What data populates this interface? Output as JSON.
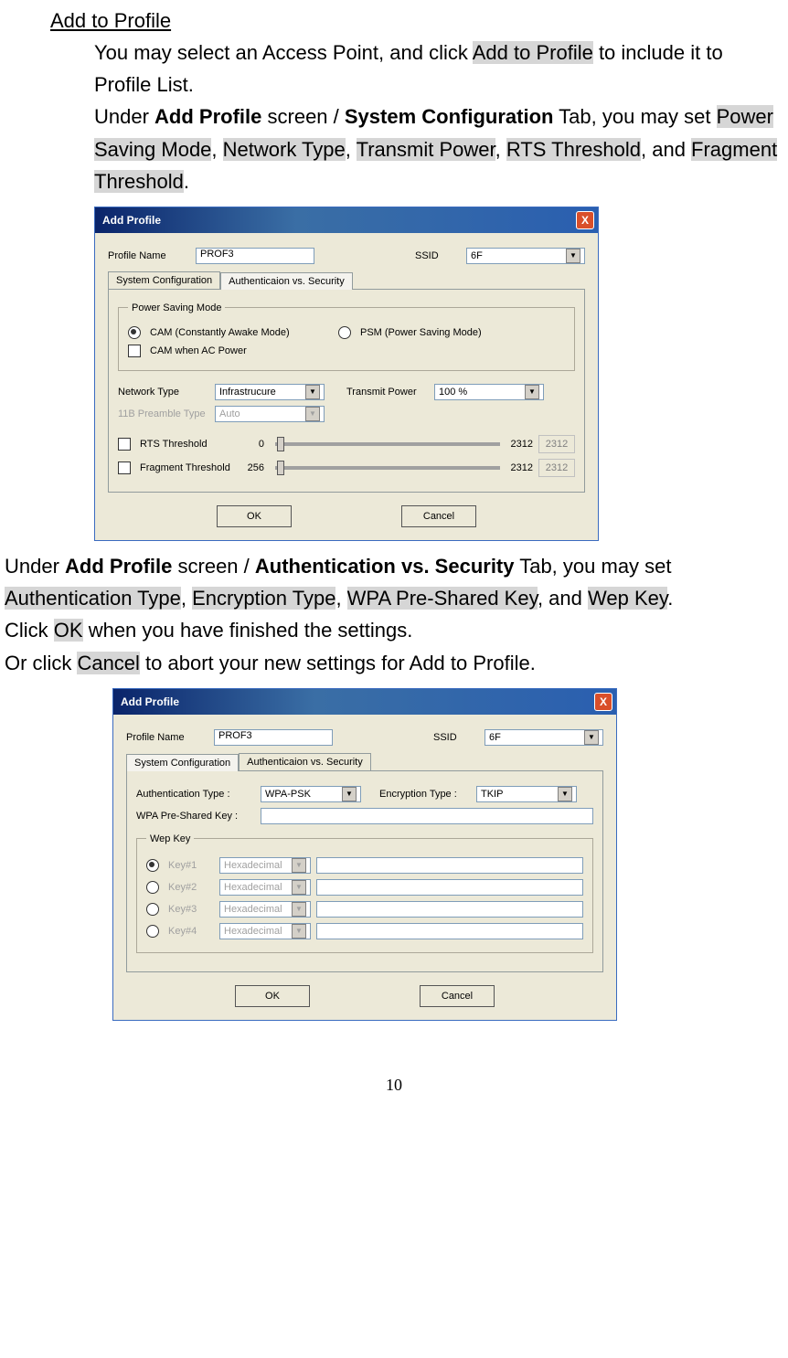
{
  "heading": "Add to Profile",
  "para1a": "You may select an Access Point, and click ",
  "hl_add_to_profile": "Add to Profile",
  "para1b": " to include it to Profile List.",
  "para2a": "Under ",
  "bold_add_profile": "Add Profile",
  "para2b": " screen / ",
  "bold_sysconf": "System Configuration",
  "para2c": " Tab, you may set ",
  "hl_psm": "Power Saving Mode",
  "comma": ", ",
  "hl_nettype": "Network Type",
  "hl_txpower": "Transmit Power",
  "hl_rts": "RTS Threshold",
  "and_text": ", and ",
  "hl_frag": "Fragment Threshold",
  "period": ".",
  "dlg1": {
    "title": "Add Profile",
    "close": "X",
    "profile_name_label": "Profile Name",
    "profile_name_value": "PROF3",
    "ssid_label": "SSID",
    "ssid_value": "6F",
    "tab_sysconf": "System Configuration",
    "tab_auth": "Authenticaion vs. Security",
    "psm_legend": "Power Saving Mode",
    "cam_label": "CAM (Constantly Awake Mode)",
    "psm_label": "PSM (Power Saving Mode)",
    "cam_ac_label": "CAM when AC Power",
    "nettype_label": "Network Type",
    "nettype_value": "Infrastrucure",
    "txpower_label": "Transmit Power",
    "txpower_value": "100 %",
    "preamble_label": "11B Preamble Type",
    "preamble_value": "Auto",
    "rts_label": "RTS Threshold",
    "rts_min": "0",
    "rts_max": "2312",
    "rts_value": "2312",
    "frag_label": "Fragment Threshold",
    "frag_min": "256",
    "frag_max": "2312",
    "frag_value": "2312",
    "ok": "OK",
    "cancel": "Cancel"
  },
  "para3a": "Under ",
  "bold_add_profile2": "Add Profile",
  "para3b": " screen / ",
  "bold_authsec": "Authentication vs. Security",
  "para3c": " Tab, you may set ",
  "hl_authtype": "Authentication Type",
  "hl_enctype": "Encryption Type",
  "hl_wpapsk": "WPA Pre-Shared Key",
  "hl_wepkey": "Wep Key",
  "para4a": "Click ",
  "hl_ok": "OK",
  "para4b": " when you have finished the settings.",
  "para5a": "Or click ",
  "hl_cancel": "Cancel",
  "para5b": " to abort your new settings for Add to Profile.",
  "dlg2": {
    "title": "Add Profile",
    "close": "X",
    "profile_name_label": "Profile Name",
    "profile_name_value": "PROF3",
    "ssid_label": "SSID",
    "ssid_value": "6F",
    "tab_sysconf": "System Configuration",
    "tab_auth": "Authenticaion vs. Security",
    "authtype_label": "Authentication Type :",
    "authtype_value": "WPA-PSK",
    "enctype_label": "Encryption Type :",
    "enctype_value": "TKIP",
    "wpapsk_label": "WPA Pre-Shared Key :",
    "wpapsk_value": "",
    "wep_legend": "Wep Key",
    "key1": "Key#1",
    "key2": "Key#2",
    "key3": "Key#3",
    "key4": "Key#4",
    "hex": "Hexadecimal",
    "ok": "OK",
    "cancel": "Cancel"
  },
  "page_number": "10"
}
